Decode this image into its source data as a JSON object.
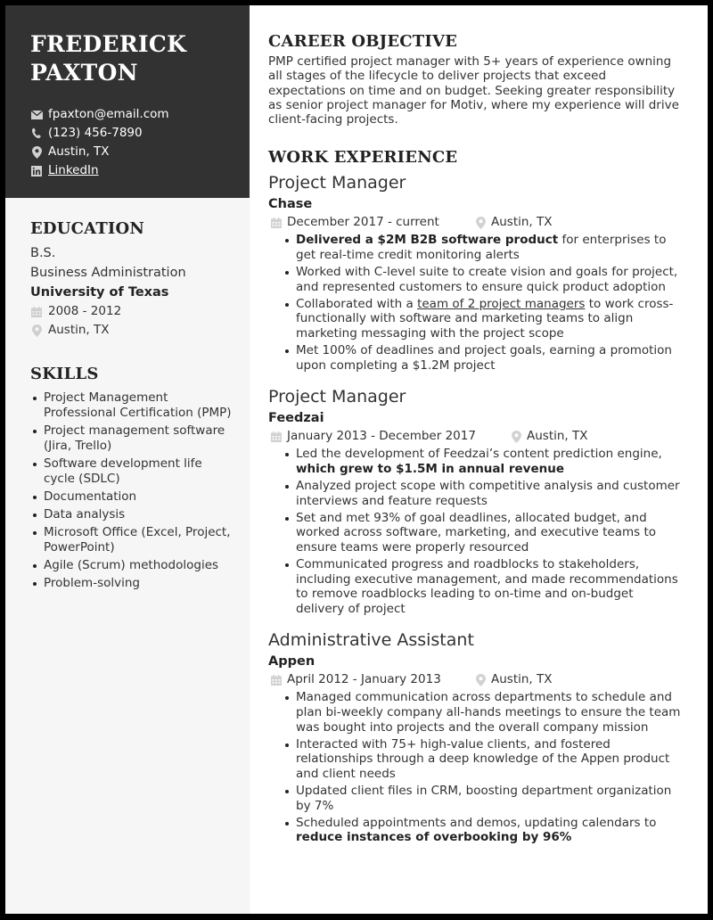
{
  "header": {
    "name_line1": "FREDERICK",
    "name_line2": "PAXTON",
    "contact": {
      "email": "fpaxton@email.com",
      "phone": "(123) 456-7890",
      "location": "Austin, TX",
      "linkedin": "LinkedIn"
    },
    "icons": [
      "envelope-icon",
      "phone-icon",
      "map-pin-icon",
      "linkedin-icon"
    ]
  },
  "education": {
    "title": "EDUCATION",
    "degree": "B.S.",
    "major": "Business Administration",
    "school": "University of Texas",
    "dates": "2008 - 2012",
    "location": "Austin, TX"
  },
  "skills": {
    "title": "SKILLS",
    "items": [
      "Project Management Professional Certification (PMP)",
      "Project management software (Jira, Trello)",
      "Software development life cycle (SDLC)",
      "Documentation",
      "Data analysis",
      "Microsoft Office (Excel, Project, PowerPoint)",
      "Agile (Scrum) methodologies",
      "Problem-solving"
    ]
  },
  "objective": {
    "title": "CAREER OBJECTIVE",
    "text": "PMP certified project manager with 5+ years of experience owning all stages of the lifecycle to deliver projects that exceed expectations on time and on budget. Seeking greater responsibility as senior project manager for Motiv, where my experience will drive client-facing projects."
  },
  "work": {
    "title": "WORK EXPERIENCE",
    "jobs": [
      {
        "title": "Project Manager",
        "company": "Chase",
        "dates": "December 2017 - current",
        "location": "Austin, TX",
        "bullets": [
          [
            {
              "t": "Delivered a $2M B2B software product",
              "b": true
            },
            {
              "t": " for enterprises to get real-time credit monitoring alerts"
            }
          ],
          [
            {
              "t": "Worked with C-level suite to create vision and goals for project, and represented customers to ensure quick product adoption"
            }
          ],
          [
            {
              "t": "Collaborated with a "
            },
            {
              "t": "team of 2 project managers",
              "u": true
            },
            {
              "t": " to work cross-functionally with software and marketing teams to align marketing messaging with the project scope"
            }
          ],
          [
            {
              "t": "Met 100% of deadlines and project goals, earning a promotion upon completing a $1.2M project"
            }
          ]
        ]
      },
      {
        "title": "Project Manager",
        "company": "Feedzai",
        "dates": "January 2013 - December 2017",
        "location": "Austin, TX",
        "bullets": [
          [
            {
              "t": "Led the development of Feedzai’s content prediction engine, "
            },
            {
              "t": "which grew to $1.5M in annual revenue",
              "b": true
            }
          ],
          [
            {
              "t": "Analyzed project scope with competitive analysis and customer interviews and feature requests"
            }
          ],
          [
            {
              "t": "Set and met 93% of goal deadlines, allocated budget, and worked across software, marketing, and executive teams to ensure teams were properly resourced"
            }
          ],
          [
            {
              "t": "Communicated progress and roadblocks to stakeholders, including executive management, and made recommendations to remove roadblocks leading to on-time and on-budget delivery of project"
            }
          ]
        ]
      },
      {
        "title": "Administrative Assistant",
        "company": "Appen",
        "dates": "April 2012 - January 2013",
        "location": "Austin, TX",
        "bullets": [
          [
            {
              "t": "Managed communication across departments to schedule and plan bi-weekly company all-hands meetings to ensure the team was bought into projects and the overall company mission"
            }
          ],
          [
            {
              "t": "Interacted with 75+ high-value clients, and fostered relationships through a deep knowledge of the Appen product and client needs"
            }
          ],
          [
            {
              "t": "Updated client files in CRM, boosting department organization by 7%"
            }
          ],
          [
            {
              "t": "Scheduled appointments and demos, updating calendars to "
            },
            {
              "t": "reduce instances of overbooking by 96%",
              "b": true
            }
          ]
        ]
      }
    ]
  },
  "colors": {
    "header_bg": "#323232",
    "sidebar_bg": "#f6f6f6",
    "text": "#333333",
    "icon_grey": "#c8c8c8",
    "frame": "#000000"
  }
}
